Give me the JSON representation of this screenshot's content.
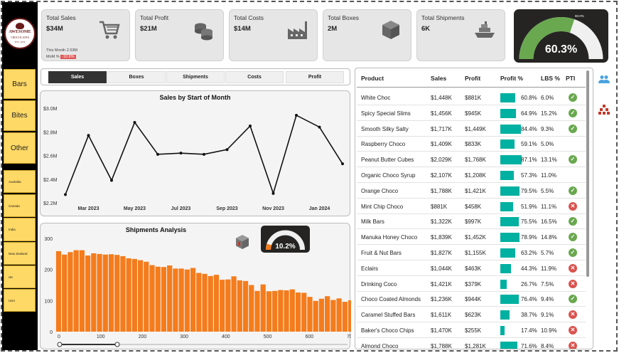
{
  "logo": {
    "line1": "AWESOME",
    "line2": "CHOCOLATES",
    "line3": "EST. 2024"
  },
  "nav": [
    {
      "label": "Bars"
    },
    {
      "label": "Bites"
    },
    {
      "label": "Other"
    }
  ],
  "countries": [
    {
      "label": "Australia"
    },
    {
      "label": "Canada"
    },
    {
      "label": "India"
    },
    {
      "label": "New Zealand"
    },
    {
      "label": "UK"
    },
    {
      "label": "USA"
    }
  ],
  "kpis": [
    {
      "title": "Total Sales",
      "value": "$34M",
      "icon": "shopping-cart-icon",
      "sub1": "This Month 2.53M",
      "sub2_label": "MoM %",
      "sub2_value": "-10.8%"
    },
    {
      "title": "Total Profit",
      "value": "$21M",
      "icon": "coins-icon"
    },
    {
      "title": "Total Costs",
      "value": "$14M",
      "icon": "factory-icon"
    },
    {
      "title": "Total Boxes",
      "value": "2M",
      "icon": "box-icon"
    },
    {
      "title": "Total Shipments",
      "value": "6K",
      "icon": "ship-icon"
    }
  ],
  "gauge": {
    "value_label": "60.3%",
    "small_label": "60.0%",
    "fraction": 0.603,
    "color": "#6aa84f"
  },
  "tabs": [
    {
      "label": "Sales",
      "active": true
    },
    {
      "label": "Boxes"
    },
    {
      "label": "Shipments"
    },
    {
      "label": "Costs"
    },
    {
      "label": "Profit"
    }
  ],
  "sales_chart": {
    "title": "Sales by Start of Month"
  },
  "shipments_chart": {
    "title": "Shipments Analysis",
    "gauge_label": "10.2%",
    "gauge_fraction": 0.102
  },
  "chart_data": [
    {
      "type": "line",
      "title": "Sales by Start of Month",
      "x": [
        "Feb 2023",
        "Mar 2023",
        "Apr 2023",
        "May 2023",
        "Jun 2023",
        "Jul 2023",
        "Aug 2023",
        "Sep 2023",
        "Oct 2023",
        "Nov 2023",
        "Dec 2023",
        "Jan 2024",
        "Feb 2024"
      ],
      "values": [
        2.27,
        2.77,
        2.39,
        2.88,
        2.61,
        2.62,
        2.61,
        2.65,
        2.85,
        2.28,
        2.94,
        2.84,
        2.53
      ],
      "xticks": [
        "Mar 2023",
        "May 2023",
        "Jul 2023",
        "Sep 2023",
        "Nov 2023",
        "Jan 2024"
      ],
      "yticks": [
        "$2.2M",
        "$2.4M",
        "$2.6M",
        "$2.8M",
        "$3.0M"
      ],
      "ylim": [
        2.2,
        3.0
      ],
      "color": "#111111"
    },
    {
      "type": "bar",
      "title": "Shipments Analysis",
      "bin_width": 14,
      "x_start": 0,
      "values": [
        259,
        248,
        256,
        262,
        262,
        245,
        252,
        250,
        248,
        249,
        247,
        243,
        236,
        234,
        230,
        225,
        214,
        209,
        208,
        213,
        203,
        203,
        200,
        205,
        189,
        186,
        179,
        183,
        167,
        168,
        178,
        165,
        163,
        150,
        131,
        152,
        130,
        131,
        134,
        133,
        136,
        126,
        125,
        112,
        99,
        106,
        114,
        102,
        107,
        96,
        101,
        95,
        87,
        84,
        89,
        92,
        78,
        72,
        71,
        79,
        66,
        63,
        70,
        65,
        63,
        55,
        51,
        54,
        44,
        48
      ],
      "xticks": [
        "0",
        "100",
        "200",
        "300",
        "400",
        "500",
        "600",
        "700"
      ],
      "yticks": [
        "0",
        "100",
        "200",
        "300"
      ],
      "ylim": [
        0,
        300
      ],
      "xlim": [
        0,
        700
      ],
      "color": "#f47c1c"
    }
  ],
  "table": {
    "headers": [
      "Product",
      "Sales",
      "Profit",
      "Profit %",
      "LBS %",
      "PTI"
    ],
    "rows": [
      {
        "product": "White Choc",
        "sales": "$1,448K",
        "profit": "$881K",
        "profit_pct": "60.8%",
        "pct": 0.608,
        "lbs": "6.0%",
        "pti": "ok"
      },
      {
        "product": "Spicy Special Slims",
        "sales": "$1,456K",
        "profit": "$945K",
        "profit_pct": "64.9%",
        "pct": 0.649,
        "lbs": "15.2%",
        "pti": "ok"
      },
      {
        "product": "Smooth Silky Salty",
        "sales": "$1,717K",
        "profit": "$1,449K",
        "profit_pct": "84.4%",
        "pct": 0.844,
        "lbs": "9.3%",
        "pti": "ok"
      },
      {
        "product": "Raspberry Choco",
        "sales": "$1,409K",
        "profit": "$833K",
        "profit_pct": "59.1%",
        "pct": 0.591,
        "lbs": "5.0%",
        "pti": ""
      },
      {
        "product": "Peanut Butter Cubes",
        "sales": "$2,029K",
        "profit": "$1,768K",
        "profit_pct": "87.1%",
        "pct": 0.871,
        "lbs": "13.1%",
        "pti": "ok"
      },
      {
        "product": "Organic Choco Syrup",
        "sales": "$2,107K",
        "profit": "$1,208K",
        "profit_pct": "57.3%",
        "pct": 0.573,
        "lbs": "11.0%",
        "pti": ""
      },
      {
        "product": "Orange Choco",
        "sales": "$1,788K",
        "profit": "$1,421K",
        "profit_pct": "79.5%",
        "pct": 0.795,
        "lbs": "5.5%",
        "pti": "ok"
      },
      {
        "product": "Mint Chip Choco",
        "sales": "$881K",
        "profit": "$458K",
        "profit_pct": "51.9%",
        "pct": 0.519,
        "lbs": "11.1%",
        "pti": "bad"
      },
      {
        "product": "Milk Bars",
        "sales": "$1,322K",
        "profit": "$997K",
        "profit_pct": "75.5%",
        "pct": 0.755,
        "lbs": "16.5%",
        "pti": "ok"
      },
      {
        "product": "Manuka Honey Choco",
        "sales": "$1,839K",
        "profit": "$1,452K",
        "profit_pct": "78.9%",
        "pct": 0.789,
        "lbs": "14.8%",
        "pti": "ok"
      },
      {
        "product": "Fruit & Nut Bars",
        "sales": "$1,827K",
        "profit": "$1,155K",
        "profit_pct": "63.2%",
        "pct": 0.632,
        "lbs": "5.7%",
        "pti": "ok"
      },
      {
        "product": "Eclairs",
        "sales": "$1,044K",
        "profit": "$463K",
        "profit_pct": "44.3%",
        "pct": 0.443,
        "lbs": "11.9%",
        "pti": "bad"
      },
      {
        "product": "Drinking Coco",
        "sales": "$1,421K",
        "profit": "$379K",
        "profit_pct": "26.7%",
        "pct": 0.267,
        "lbs": "7.5%",
        "pti": "bad"
      },
      {
        "product": "Choco Coated Almonds",
        "sales": "$1,236K",
        "profit": "$944K",
        "profit_pct": "76.4%",
        "pct": 0.764,
        "lbs": "9.4%",
        "pti": "ok"
      },
      {
        "product": "Caramel Stuffed Bars",
        "sales": "$1,611K",
        "profit": "$623K",
        "profit_pct": "38.7%",
        "pct": 0.387,
        "lbs": "9.1%",
        "pti": "bad"
      },
      {
        "product": "Baker's Choco Chips",
        "sales": "$1,470K",
        "profit": "$255K",
        "profit_pct": "17.4%",
        "pct": 0.174,
        "lbs": "10.9%",
        "pti": "bad"
      },
      {
        "product": "Almond Choco",
        "sales": "$1,788K",
        "profit": "$1,281K",
        "profit_pct": "71.6%",
        "pct": 0.716,
        "lbs": "8.4%",
        "pti": "bad"
      }
    ]
  },
  "colors": {
    "accent_bar": "#00b0a0",
    "nav_bg": "#ffd966",
    "shipments": "#f47c1c",
    "ok": "#6aa84f",
    "bad": "#d9534f"
  },
  "side_icons": [
    "people-icon",
    "hierarchy-icon"
  ]
}
